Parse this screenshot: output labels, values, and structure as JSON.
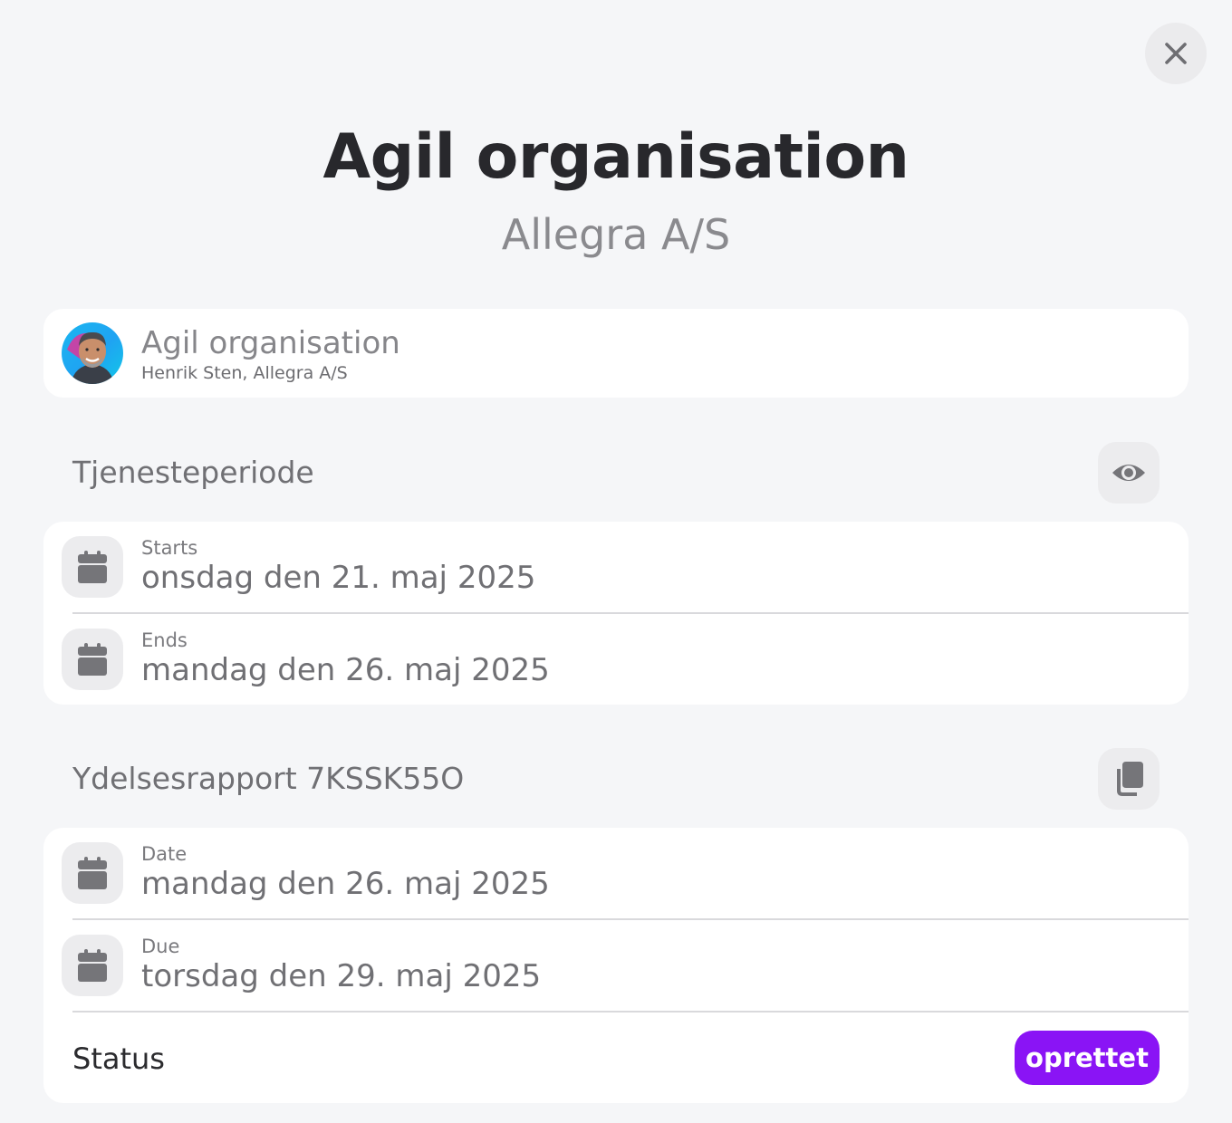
{
  "header": {
    "title": "Agil organisation",
    "subtitle": "Allegra A/S"
  },
  "client": {
    "name": "Agil organisation",
    "detail": "Henrik Sten, Allegra A/S"
  },
  "service_period": {
    "title": "Tjenesteperiode",
    "rows": [
      {
        "label": "Starts",
        "value": "onsdag den 21. maj 2025"
      },
      {
        "label": "Ends",
        "value": "mandag den 26. maj 2025"
      }
    ]
  },
  "report": {
    "title": "Ydelsesrapport 7KSSK55O",
    "rows": [
      {
        "label": "Date",
        "value": "mandag den 26. maj 2025"
      },
      {
        "label": "Due",
        "value": "torsdag den 29. maj 2025"
      }
    ],
    "status_label": "Status",
    "status_value": "oprettet"
  },
  "colors": {
    "accent": "#8a14f5",
    "icon_gray": "#757579",
    "background": "#f5f6f8"
  },
  "icons": {
    "close": "close-icon",
    "view": "eye-icon",
    "copy": "copy-icon",
    "calendar": "calendar-icon"
  }
}
